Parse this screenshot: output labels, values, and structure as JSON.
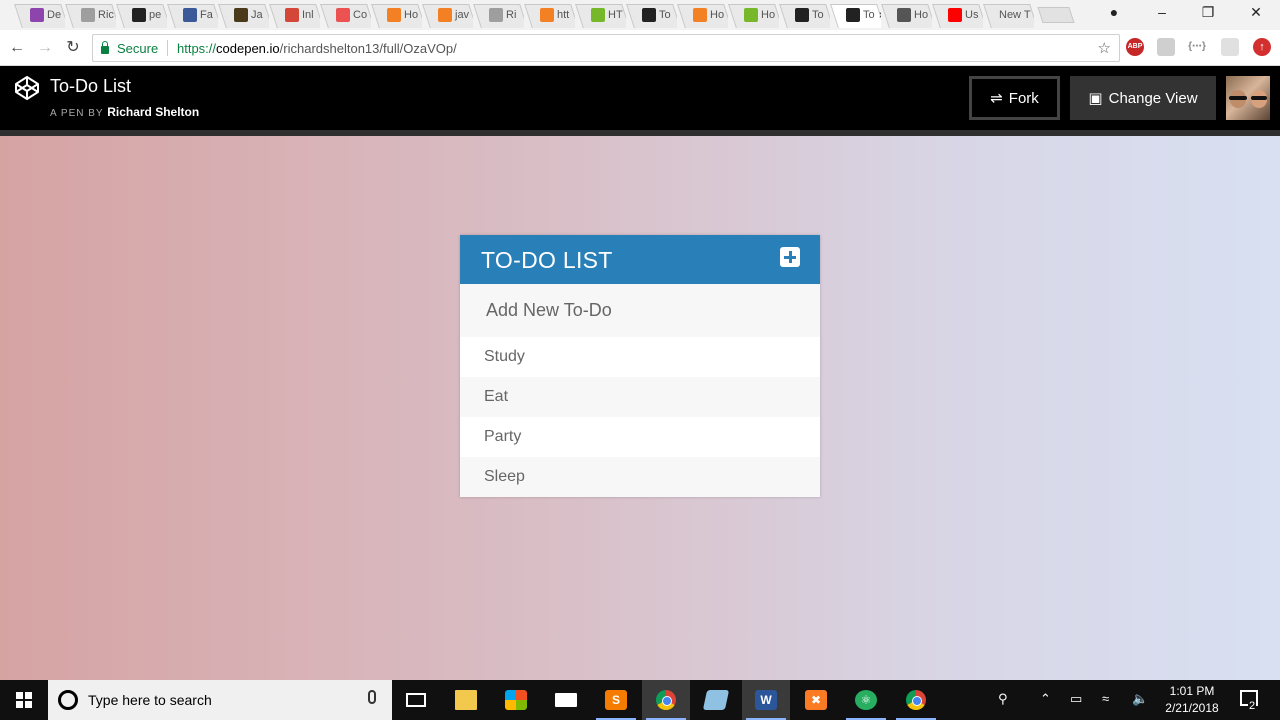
{
  "browser": {
    "tabs": [
      {
        "icon": "cube-icon",
        "label": "De",
        "color": "#8e44ad"
      },
      {
        "icon": "page-icon",
        "label": "Ric",
        "color": "#9e9e9e"
      },
      {
        "icon": "github-icon",
        "label": "pe",
        "color": "#222222"
      },
      {
        "icon": "facebook-icon",
        "label": "Fa",
        "color": "#3b5998"
      },
      {
        "icon": "thirty-icon",
        "label": "Ja",
        "color": "#4a3a1a"
      },
      {
        "icon": "gmail-icon",
        "label": "Inl",
        "color": "#d44638"
      },
      {
        "icon": "udemy-icon",
        "label": "Co",
        "color": "#ec5252"
      },
      {
        "icon": "stack-icon",
        "label": "Ho",
        "color": "#f48024"
      },
      {
        "icon": "stack-icon",
        "label": "jav",
        "color": "#f48024"
      },
      {
        "icon": "page-icon",
        "label": "Ri",
        "color": "#9e9e9e"
      },
      {
        "icon": "stack-icon",
        "label": "htt",
        "color": "#f48024"
      },
      {
        "icon": "html-icon",
        "label": "HT",
        "color": "#76b82a"
      },
      {
        "icon": "nyt-icon",
        "label": "To",
        "color": "#222222"
      },
      {
        "icon": "stack-icon",
        "label": "Ho",
        "color": "#f48024"
      },
      {
        "icon": "html-icon",
        "label": "Ho",
        "color": "#76b82a"
      },
      {
        "icon": "codepen-icon",
        "label": "To",
        "color": "#222222"
      },
      {
        "icon": "codepen-icon",
        "label": "To",
        "color": "#222222",
        "active": true
      },
      {
        "icon": "stripes-icon",
        "label": "Ho",
        "color": "#555555"
      },
      {
        "icon": "youtube-icon",
        "label": "Us",
        "color": "#ff0000"
      },
      {
        "icon": "",
        "label": "New T",
        "color": ""
      }
    ],
    "secure_label": "Secure",
    "url_scheme": "https://",
    "url_host": "codepen.io",
    "url_path": "/richardshelton13/full/OzaVOp/"
  },
  "codepen": {
    "title": "To-Do List",
    "byline": "A PEN BY",
    "author": "Richard Shelton",
    "fork_label": "Fork",
    "view_label": "Change View"
  },
  "todo": {
    "title": "TO-DO LIST",
    "input_placeholder": "Add New To-Do",
    "items": [
      "Study",
      "Eat",
      "Party",
      "Sleep"
    ],
    "accent": "#2980b9"
  },
  "taskbar": {
    "search_placeholder": "Type here to search",
    "time": "1:01 PM",
    "date": "2/21/2018",
    "notification_count": "2"
  }
}
